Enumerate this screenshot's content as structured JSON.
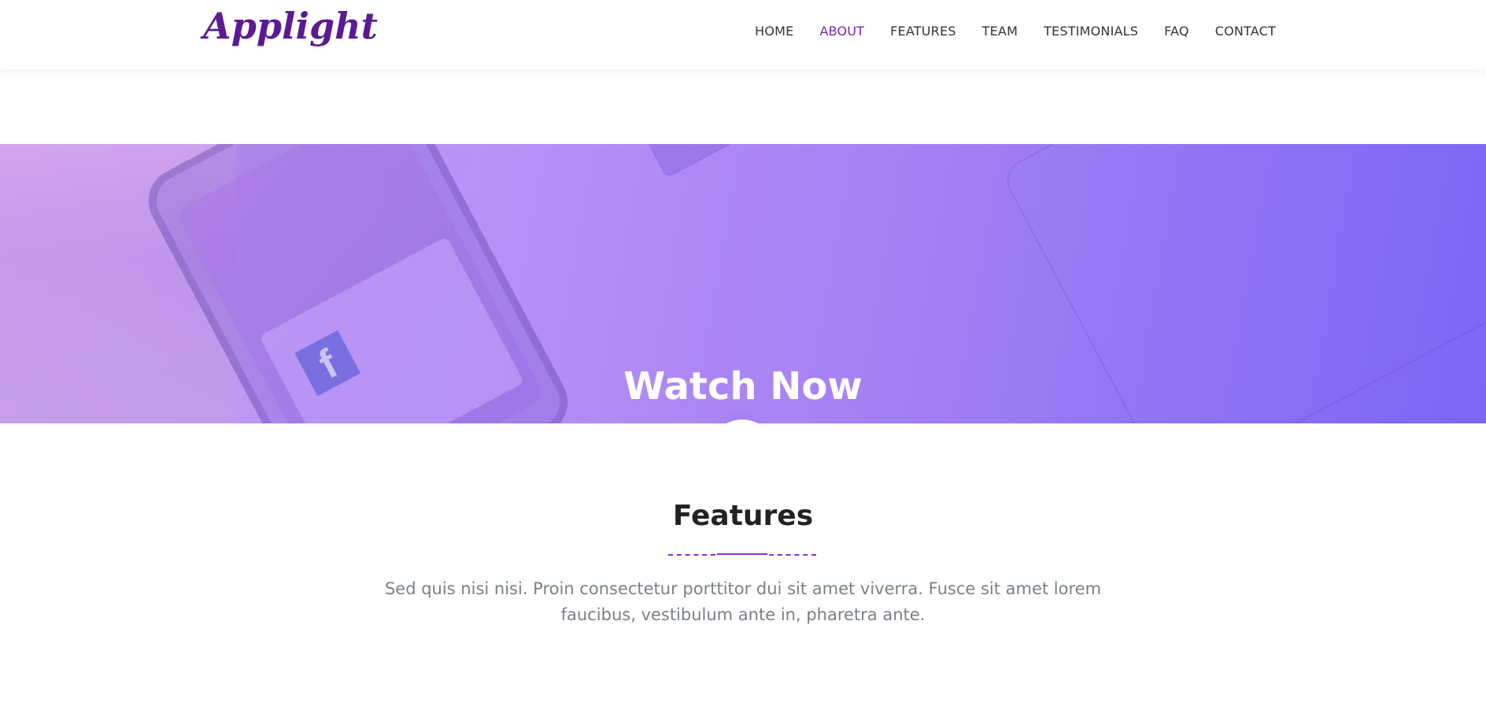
{
  "header": {
    "logo_text": "Applight",
    "nav": {
      "home": "HOME",
      "about": "ABOUT",
      "features": "FEATURES",
      "team": "TEAM",
      "testimonials": "TESTIMONIALS",
      "faq": "FAQ",
      "contact": "CONTACT"
    },
    "active_item": "ABOUT"
  },
  "banner": {
    "title": "Watch Now",
    "play_icon": "play-icon"
  },
  "features": {
    "title": "Features",
    "description": "Sed quis nisi nisi. Proin consectetur porttitor dui sit amet viverra. Fusce sit amet lorem faucibus, vestibulum ante in, pharetra ante."
  },
  "colors": {
    "brand": "#5b1a94",
    "accent": "#8a1be6",
    "banner_start": "#c7a0f0",
    "banner_end": "#7c66f3"
  }
}
